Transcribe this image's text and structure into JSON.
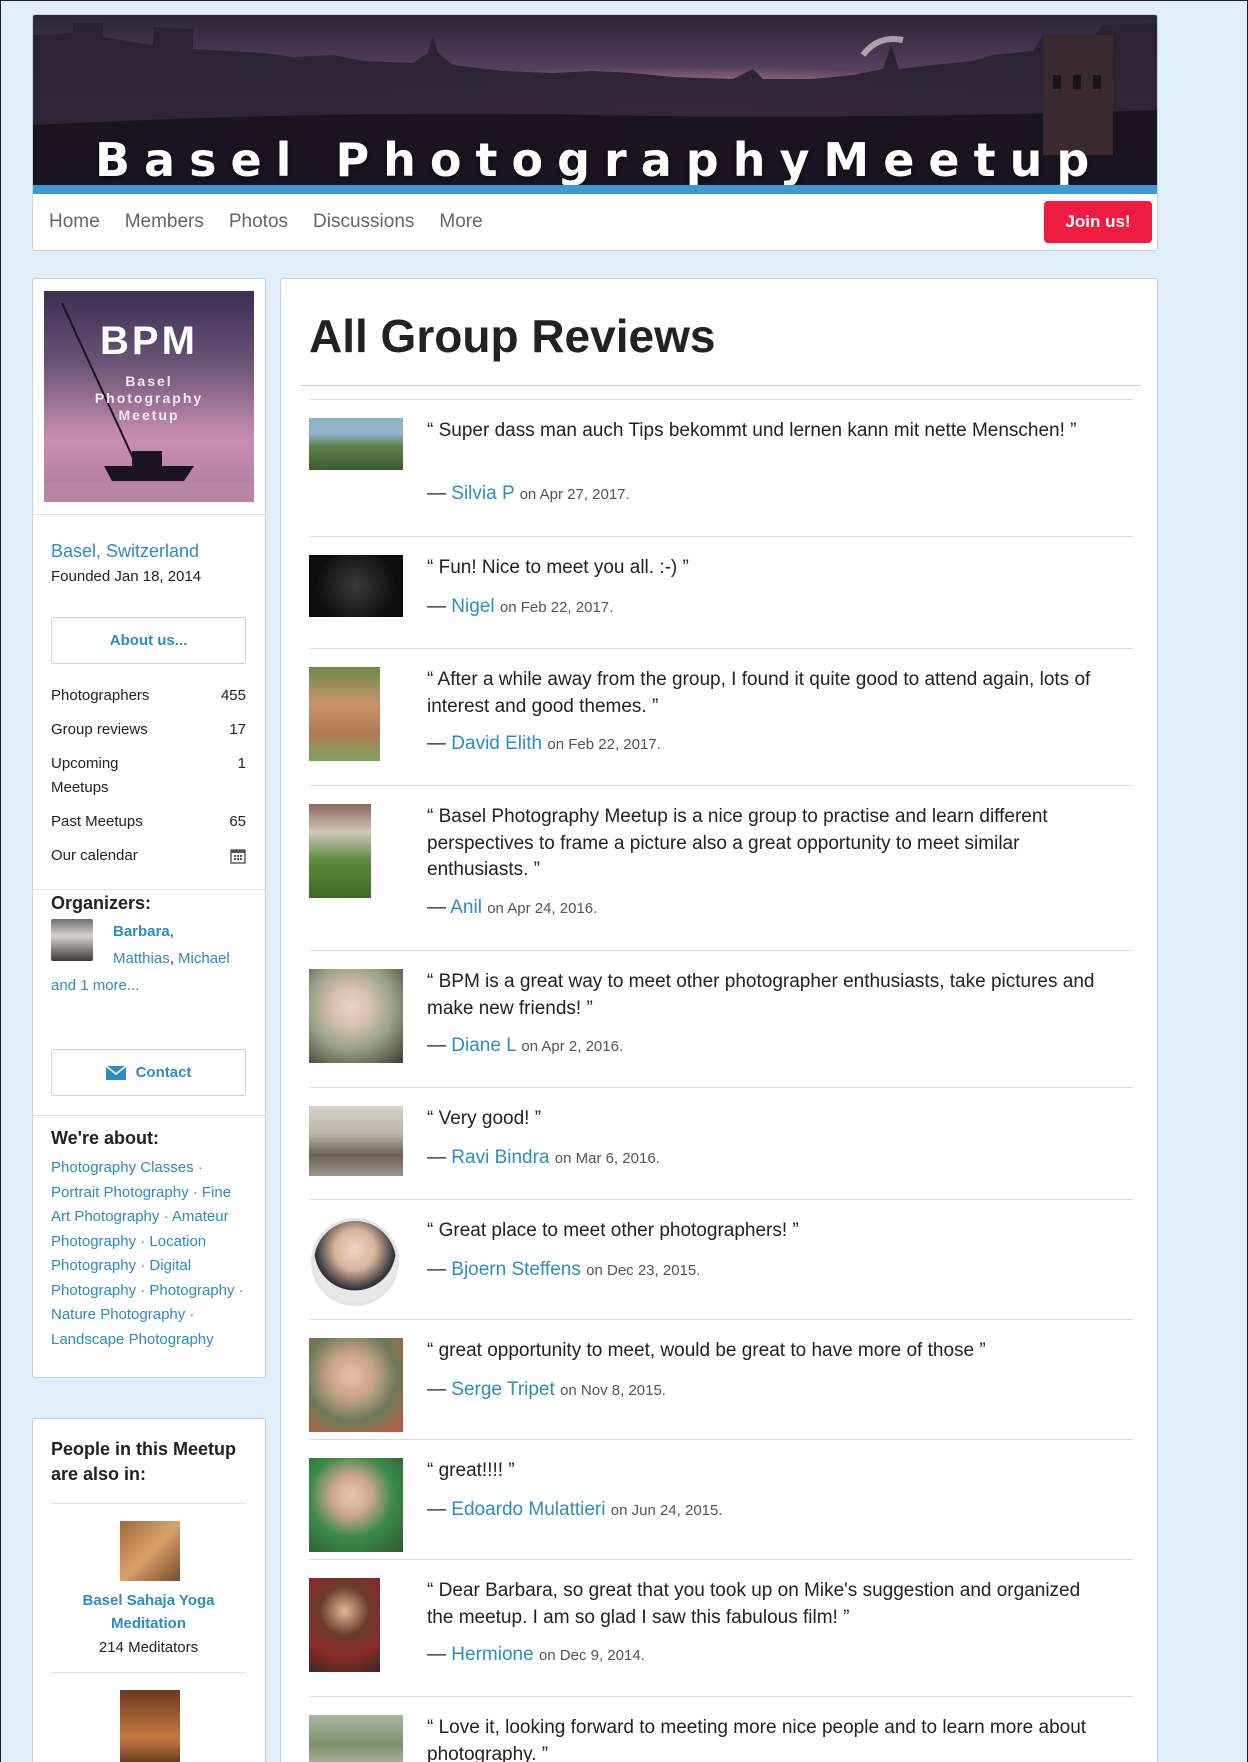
{
  "header": {
    "title": "Basel PhotographyMeetup",
    "nav": [
      "Home",
      "Members",
      "Photos",
      "Discussions",
      "More"
    ],
    "join_label": "Join us!"
  },
  "sidebar": {
    "logo_text": "BPM",
    "logo_sub": [
      "Basel",
      "Photography",
      "Meetup"
    ],
    "location": "Basel, Switzerland",
    "founded": "Founded Jan 18, 2014",
    "about_label": "About us...",
    "stats": [
      {
        "label": "Photographers",
        "value": "455"
      },
      {
        "label": "Group reviews",
        "value": "17"
      },
      {
        "label": "Upcoming Meetups",
        "value": "1"
      },
      {
        "label": "Past Meetups",
        "value": "65"
      },
      {
        "label": "Our calendar",
        "icon": "calendar-icon"
      }
    ],
    "organizers_heading": "Organizers:",
    "organizers": {
      "first": "Barbara",
      "second": "Matthias",
      "third": "Michael",
      "more": "and 1 more..."
    },
    "contact_label": "Contact",
    "about_heading": "We're about:",
    "topics": [
      "Photography Classes",
      "Portrait Photography",
      "Fine Art Photography",
      "Amateur Photography",
      "Location Photography",
      "Digital Photography",
      "Photography",
      "Nature Photography",
      "Landscape Photography"
    ]
  },
  "also_in": {
    "heading": "People in this Meetup are also in:",
    "groups": [
      {
        "name": "Basel Sahaja Yoga Meditation",
        "count": "214 Meditators"
      }
    ]
  },
  "main": {
    "title": "All Group Reviews",
    "reviews": [
      {
        "quote": "“ Super dass man auch Tips bekommt und lernen kann mit nette Menschen! ”",
        "name": "Silvia P",
        "date": "on Apr 27, 2017."
      },
      {
        "quote": "“ Fun! Nice to meet you all. :-) ”",
        "name": "Nigel",
        "date": "on Feb 22, 2017."
      },
      {
        "quote": "“ After a while away from the group, I found it quite good to attend again, lots of interest and good themes. ”",
        "name": "David Elith",
        "date": "on Feb 22, 2017."
      },
      {
        "quote": "“ Basel Photography Meetup is a nice group to practise and learn different perspectives to frame a picture also a great opportunity to meet similar enthusiasts. ”",
        "name": "Anil",
        "date": "on Apr 24, 2016."
      },
      {
        "quote": "“ BPM is a great way to meet other photographer enthusiasts, take pictures and make new friends! ”",
        "name": "Diane L",
        "date": "on Apr 2, 2016."
      },
      {
        "quote": "“ Very good! ”",
        "name": "Ravi Bindra",
        "date": "on Mar 6, 2016."
      },
      {
        "quote": "“ Great place to meet other photographers! ”",
        "name": "Bjoern Steffens",
        "date": "on Dec 23, 2015."
      },
      {
        "quote": "“ great opportunity to meet, would be great to have more of those ”",
        "name": "Serge Tripet",
        "date": "on Nov 8, 2015."
      },
      {
        "quote": "“ great!!!! ”",
        "name": "Edoardo Mulattieri",
        "date": "on Jun 24, 2015."
      },
      {
        "quote": "“ Dear Barbara, so great that you took up on Mike's suggestion and organized the meetup. I am so glad I saw this fabulous film! ”",
        "name": "Hermione",
        "date": "on Dec 9, 2014."
      },
      {
        "quote": "“ Love it, looking forward to meeting more nice people and to learn more about photography. ”",
        "name": "",
        "date": ""
      }
    ]
  },
  "colors": {
    "accent": "#2e8cc1",
    "join": "#ed1c40",
    "background": "#dfeef8",
    "banner_strip": "#3b9bd0"
  }
}
